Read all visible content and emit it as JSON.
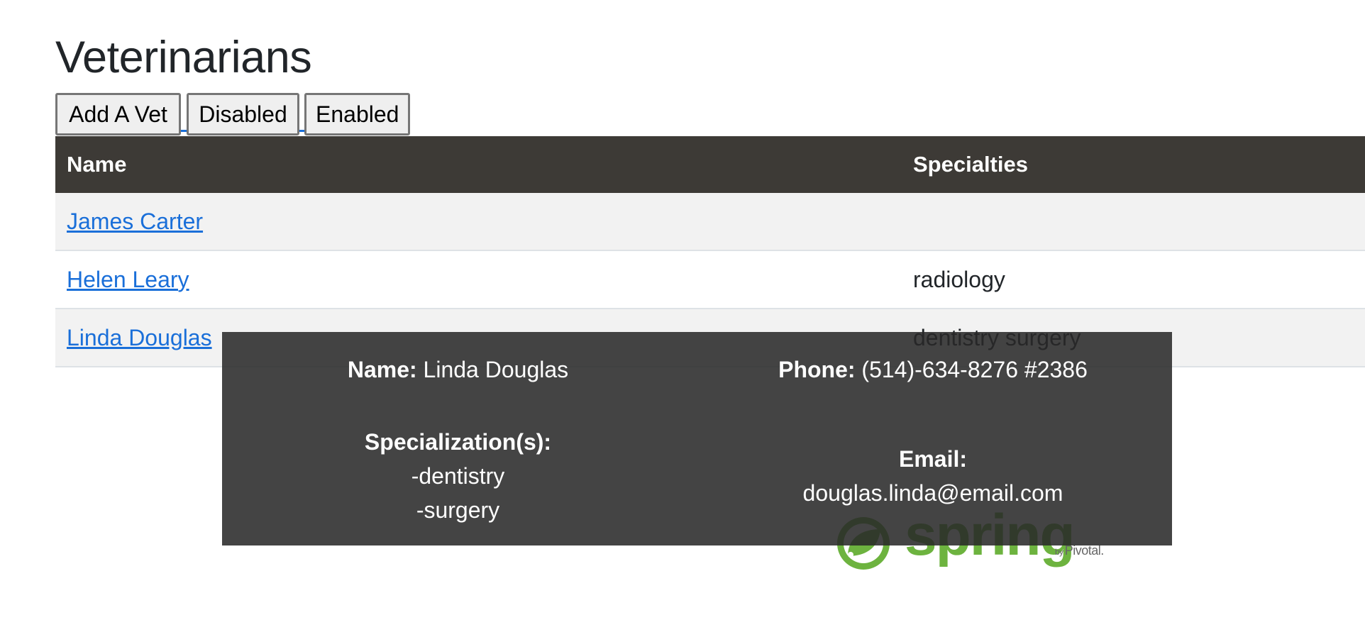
{
  "page": {
    "title": "Veterinarians"
  },
  "buttons": {
    "add_vet": "Add A Vet",
    "disabled": "Disabled",
    "enabled": "Enabled"
  },
  "table": {
    "headers": {
      "name": "Name",
      "specialties": "Specialties"
    },
    "rows": [
      {
        "name": "James Carter",
        "specialties": ""
      },
      {
        "name": "Helen Leary",
        "specialties": "radiology"
      },
      {
        "name": "Linda Douglas",
        "specialties": "dentistry surgery"
      }
    ]
  },
  "popup": {
    "name_label": "Name:",
    "name_value": "Linda Douglas",
    "phone_label": "Phone:",
    "phone_value": "(514)-634-8276 #2386",
    "spec_label": "Specialization(s):",
    "spec_items": [
      "-dentistry",
      "-surgery"
    ],
    "email_label": "Email:",
    "email_value": "douglas.linda@email.com"
  },
  "logo": {
    "word": "spring",
    "by_prefix": "by",
    "by_name": "Pivotal."
  },
  "colors": {
    "header_bg": "#3d3a36",
    "link": "#1a6fd9",
    "logo_green": "#6db33f",
    "popup_bg": "#282828"
  }
}
